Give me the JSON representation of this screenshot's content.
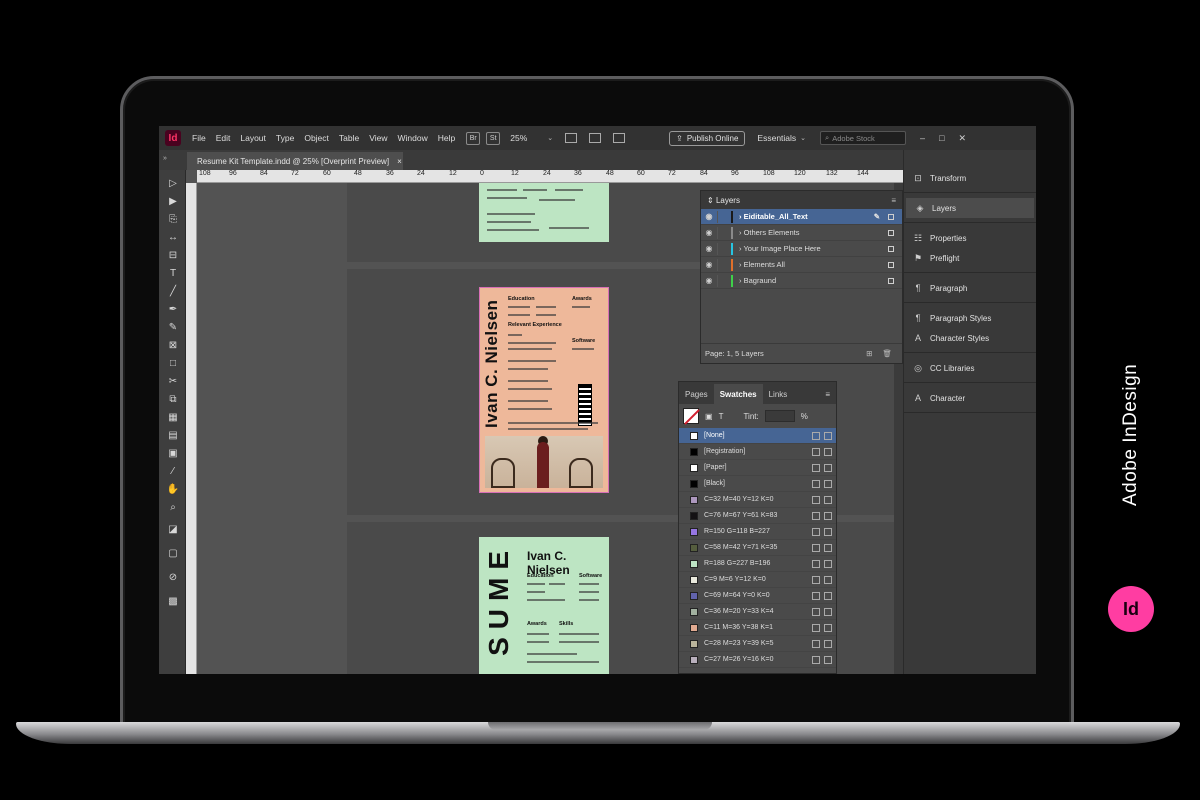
{
  "app": {
    "logo": "Id",
    "menu": [
      "File",
      "Edit",
      "Layout",
      "Type",
      "Object",
      "Table",
      "View",
      "Window",
      "Help"
    ],
    "bridge_btn": "Br",
    "stock_btn": "St",
    "zoom": "25%",
    "publish": "Publish Online",
    "workspace": "Essentials",
    "search_placeholder": "Adobe Stock",
    "window_controls": [
      "–",
      "□",
      "✕"
    ]
  },
  "document": {
    "tab_title": "Resume Kit Template.indd @ 25% [Overprint Preview]",
    "tab_close": "×",
    "ruler_labels": [
      "108",
      "96",
      "84",
      "72",
      "60",
      "48",
      "36",
      "24",
      "12",
      "0",
      "12",
      "24",
      "36",
      "48",
      "60",
      "72",
      "84",
      "96",
      "108",
      "120",
      "132",
      "144"
    ]
  },
  "pages": {
    "name": "Ivan C. Nielsen",
    "vertical_word": "SUME",
    "sections": [
      "Education",
      "Awards",
      "Relevant Experience",
      "Software",
      "Skills"
    ]
  },
  "layers_panel": {
    "title": "Layers",
    "layers": [
      {
        "name": "Eiditable_All_Text",
        "color": "#1a1a1a",
        "selected": true
      },
      {
        "name": "Others Elements",
        "color": "#8a8a8a",
        "selected": false
      },
      {
        "name": "Your Image Place Here",
        "color": "#27c4e0",
        "selected": false
      },
      {
        "name": "Elements All",
        "color": "#e0702a",
        "selected": false
      },
      {
        "name": "Bagraund",
        "color": "#3fd04a",
        "selected": false
      }
    ],
    "footer": "Page: 1, 5 Layers"
  },
  "swatches_panel": {
    "tabs": [
      "Pages",
      "Swatches",
      "Links"
    ],
    "active_tab": "Swatches",
    "tint_label": "Tint:",
    "tint_unit": "%",
    "swatches": [
      {
        "name": "[None]",
        "color": "#ffffff",
        "selected": true
      },
      {
        "name": "[Registration]",
        "color": "#000000",
        "selected": false
      },
      {
        "name": "[Paper]",
        "color": "#ffffff",
        "selected": false
      },
      {
        "name": "[Black]",
        "color": "#000000",
        "selected": false
      },
      {
        "name": "C=32 M=40 Y=12 K=0",
        "color": "#ad98be",
        "selected": false
      },
      {
        "name": "C=76 M=67 Y=61 K=83",
        "color": "#141214",
        "selected": false
      },
      {
        "name": "R=150 G=118 B=227",
        "color": "#9676e3",
        "selected": false
      },
      {
        "name": "C=58 M=42 Y=71 K=35",
        "color": "#555d3e",
        "selected": false
      },
      {
        "name": "R=188 G=227 B=196",
        "color": "#bce3c4",
        "selected": false
      },
      {
        "name": "C=9 M=6 Y=12 K=0",
        "color": "#e9e9dd",
        "selected": false
      },
      {
        "name": "C=69 M=64 Y=0 K=0",
        "color": "#6163ac",
        "selected": false
      },
      {
        "name": "C=36 M=20 Y=33 K=4",
        "color": "#a2b1a0",
        "selected": false
      },
      {
        "name": "C=11 M=36 Y=38 K=1",
        "color": "#e1aa91",
        "selected": false
      },
      {
        "name": "C=28 M=23 Y=39 K=5",
        "color": "#b9b49b",
        "selected": false
      },
      {
        "name": "C=27 M=26 Y=16 K=0",
        "color": "#b9b0bd",
        "selected": false
      }
    ]
  },
  "dock": {
    "items": [
      "Transform",
      "Layers",
      "Properties",
      "Preflight",
      "Paragraph",
      "Paragraph Styles",
      "Character Styles",
      "CC Libraries",
      "Character"
    ],
    "active": "Layers"
  },
  "brand": {
    "name": "Adobe InDesign",
    "badge": "Id"
  },
  "colors": {
    "accent_selected": "#466594",
    "indesign_pink": "#ff3da2"
  }
}
